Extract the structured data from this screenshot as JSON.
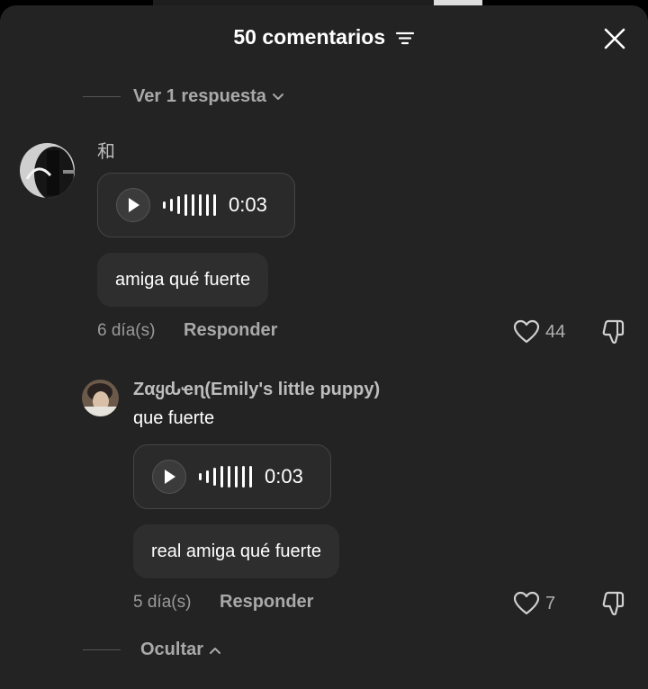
{
  "header": {
    "title": "50 comentarios"
  },
  "thread_toggle": {
    "view_replies": "Ver 1 respuesta",
    "hide": "Ocultar"
  },
  "comment": {
    "author": "和",
    "audio_duration": "0:03",
    "text": "amiga qué fuerte",
    "time": "6 día(s)",
    "reply_label": "Responder",
    "likes": "44"
  },
  "reply": {
    "author": "Zαყԃҽɳ(Emily's little puppy)",
    "text": "que fuerte",
    "audio_duration": "0:03",
    "bubble_text": "real amiga qué fuerte",
    "time": "5 día(s)",
    "reply_label": "Responder",
    "likes": "7"
  },
  "icons": [
    "filter-icon",
    "close-icon",
    "chevron-down-icon",
    "play-icon",
    "waveform-icon",
    "heart-icon",
    "dislike-icon",
    "chevron-up-icon"
  ],
  "colors": {
    "sheet_bg": "#232323",
    "secondary_text": "#a9a9a9"
  }
}
